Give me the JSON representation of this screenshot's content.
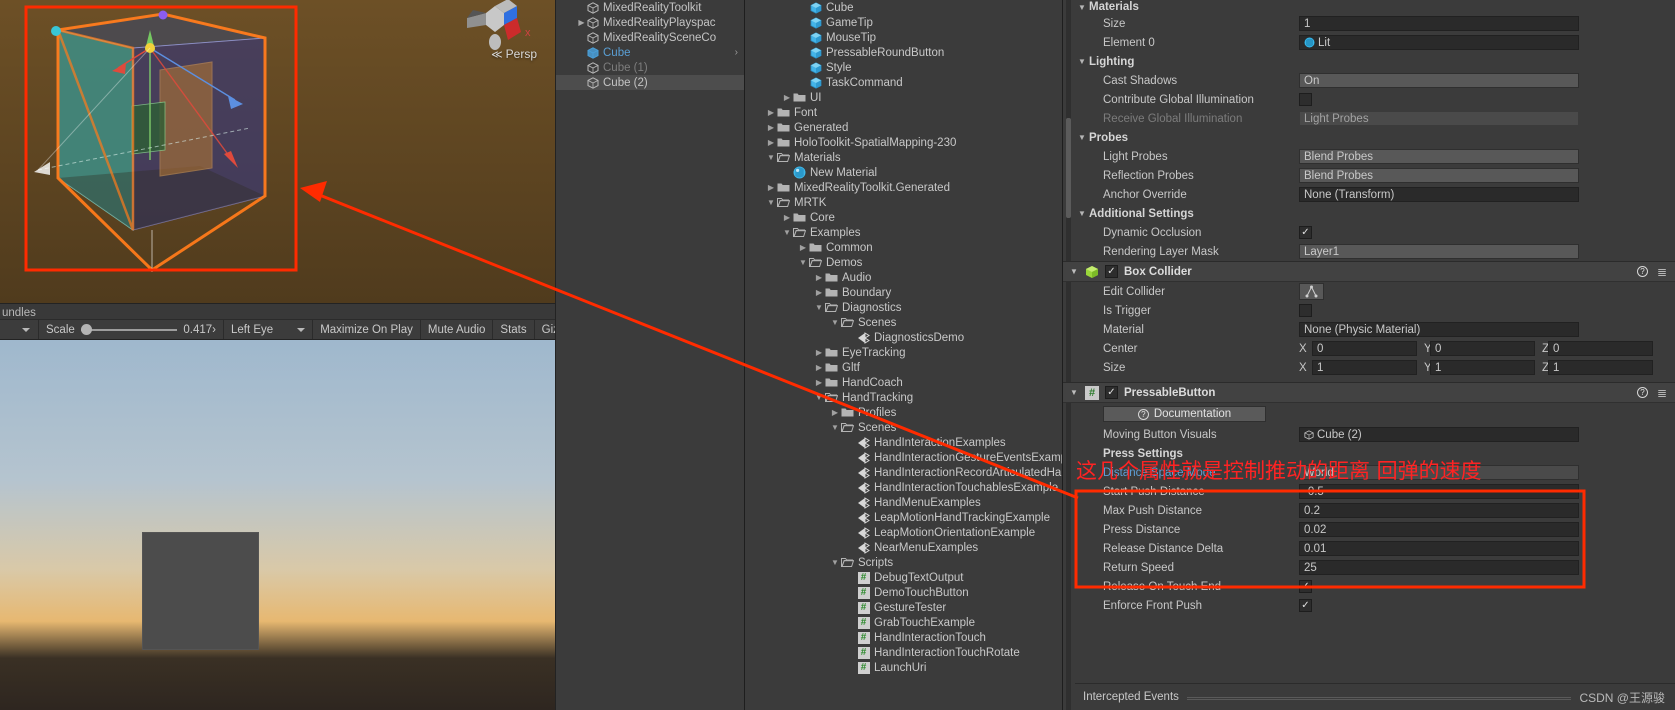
{
  "scene_view": {
    "persp_label": "Persp",
    "persp_chevron": "≪"
  },
  "game_view": {
    "tab_label": "undles",
    "toolbar": {
      "display_caret": "▾",
      "scale_label": "Scale",
      "scale_value": "0.417›",
      "eye_label": "Left Eye",
      "eye_caret": "▾",
      "maximize_on_play": "Maximize On Play",
      "mute_audio": "Mute Audio",
      "stats": "Stats",
      "gizmos": "Gizmos",
      "gizmos_caret": "▾"
    }
  },
  "hierarchy": {
    "items": [
      {
        "label": "MixedRealityToolkit",
        "arrow": "",
        "selected": false,
        "active": false,
        "dim": false
      },
      {
        "label": "MixedRealityPlayspac",
        "arrow": "▶",
        "selected": false,
        "active": false,
        "dim": false
      },
      {
        "label": "MixedRealitySceneCo",
        "arrow": "",
        "selected": false,
        "active": false,
        "dim": false
      },
      {
        "label": "Cube",
        "arrow": "",
        "selected": false,
        "active": true,
        "dim": false,
        "more": "›"
      },
      {
        "label": "Cube (1)",
        "arrow": "",
        "selected": false,
        "active": false,
        "dim": true
      },
      {
        "label": "Cube (2)",
        "arrow": "",
        "selected": true,
        "active": false,
        "dim": false
      }
    ]
  },
  "project": {
    "items": [
      {
        "label": "Cube",
        "indent": 3,
        "arrow": "",
        "icon": "prefab",
        "open": false
      },
      {
        "label": "GameTip",
        "indent": 3,
        "arrow": "",
        "icon": "prefab",
        "open": false
      },
      {
        "label": "MouseTip",
        "indent": 3,
        "arrow": "",
        "icon": "prefab",
        "open": false
      },
      {
        "label": "PressableRoundButton",
        "indent": 3,
        "arrow": "",
        "icon": "prefab",
        "open": false
      },
      {
        "label": "Style",
        "indent": 3,
        "arrow": "",
        "icon": "prefab",
        "open": false
      },
      {
        "label": "TaskCommand",
        "indent": 3,
        "arrow": "",
        "icon": "prefab",
        "open": false
      },
      {
        "label": "UI",
        "indent": 2,
        "arrow": "▶",
        "icon": "folder",
        "open": false
      },
      {
        "label": "Font",
        "indent": 1,
        "arrow": "▶",
        "icon": "folder",
        "open": false
      },
      {
        "label": "Generated",
        "indent": 1,
        "arrow": "▶",
        "icon": "folder",
        "open": false
      },
      {
        "label": "HoloToolkit-SpatialMapping-230",
        "indent": 1,
        "arrow": "▶",
        "icon": "folder",
        "open": false
      },
      {
        "label": "Materials",
        "indent": 1,
        "arrow": "▼",
        "icon": "folder",
        "open": true
      },
      {
        "label": "New Material",
        "indent": 2,
        "arrow": "",
        "icon": "material",
        "open": false
      },
      {
        "label": "MixedRealityToolkit.Generated",
        "indent": 1,
        "arrow": "▶",
        "icon": "folder",
        "open": false
      },
      {
        "label": "MRTK",
        "indent": 1,
        "arrow": "▼",
        "icon": "folder",
        "open": true
      },
      {
        "label": "Core",
        "indent": 2,
        "arrow": "▶",
        "icon": "folder",
        "open": false
      },
      {
        "label": "Examples",
        "indent": 2,
        "arrow": "▼",
        "icon": "folder",
        "open": true
      },
      {
        "label": "Common",
        "indent": 3,
        "arrow": "▶",
        "icon": "folder",
        "open": false
      },
      {
        "label": "Demos",
        "indent": 3,
        "arrow": "▼",
        "icon": "folder",
        "open": true
      },
      {
        "label": "Audio",
        "indent": 4,
        "arrow": "▶",
        "icon": "folder",
        "open": false
      },
      {
        "label": "Boundary",
        "indent": 4,
        "arrow": "▶",
        "icon": "folder",
        "open": false
      },
      {
        "label": "Diagnostics",
        "indent": 4,
        "arrow": "▼",
        "icon": "folder",
        "open": true
      },
      {
        "label": "Scenes",
        "indent": 5,
        "arrow": "▼",
        "icon": "folder",
        "open": true
      },
      {
        "label": "DiagnosticsDemo",
        "indent": 6,
        "arrow": "",
        "icon": "scene",
        "open": false
      },
      {
        "label": "EyeTracking",
        "indent": 4,
        "arrow": "▶",
        "icon": "folder",
        "open": false
      },
      {
        "label": "Gltf",
        "indent": 4,
        "arrow": "▶",
        "icon": "folder",
        "open": false
      },
      {
        "label": "HandCoach",
        "indent": 4,
        "arrow": "▶",
        "icon": "folder",
        "open": false
      },
      {
        "label": "HandTracking",
        "indent": 4,
        "arrow": "▼",
        "icon": "folder",
        "open": true
      },
      {
        "label": "Profiles",
        "indent": 5,
        "arrow": "▶",
        "icon": "folder",
        "open": false
      },
      {
        "label": "Scenes",
        "indent": 5,
        "arrow": "▼",
        "icon": "folder",
        "open": true
      },
      {
        "label": "HandInteractionExamples",
        "indent": 6,
        "arrow": "",
        "icon": "scene",
        "open": false
      },
      {
        "label": "HandInteractionGestureEventsExamp",
        "indent": 6,
        "arrow": "",
        "icon": "scene",
        "open": false
      },
      {
        "label": "HandInteractionRecordArticulatedHa",
        "indent": 6,
        "arrow": "",
        "icon": "scene",
        "open": false
      },
      {
        "label": "HandInteractionTouchablesExample",
        "indent": 6,
        "arrow": "",
        "icon": "scene",
        "open": false
      },
      {
        "label": "HandMenuExamples",
        "indent": 6,
        "arrow": "",
        "icon": "scene",
        "open": false
      },
      {
        "label": "LeapMotionHandTrackingExample",
        "indent": 6,
        "arrow": "",
        "icon": "scene",
        "open": false
      },
      {
        "label": "LeapMotionOrientationExample",
        "indent": 6,
        "arrow": "",
        "icon": "scene",
        "open": false
      },
      {
        "label": "NearMenuExamples",
        "indent": 6,
        "arrow": "",
        "icon": "scene",
        "open": false
      },
      {
        "label": "Scripts",
        "indent": 5,
        "arrow": "▼",
        "icon": "folder",
        "open": true
      },
      {
        "label": "DebugTextOutput",
        "indent": 6,
        "arrow": "",
        "icon": "script",
        "open": false
      },
      {
        "label": "DemoTouchButton",
        "indent": 6,
        "arrow": "",
        "icon": "script",
        "open": false
      },
      {
        "label": "GestureTester",
        "indent": 6,
        "arrow": "",
        "icon": "script",
        "open": false
      },
      {
        "label": "GrabTouchExample",
        "indent": 6,
        "arrow": "",
        "icon": "script",
        "open": false
      },
      {
        "label": "HandInteractionTouch",
        "indent": 6,
        "arrow": "",
        "icon": "script",
        "open": false
      },
      {
        "label": "HandInteractionTouchRotate",
        "indent": 6,
        "arrow": "",
        "icon": "script",
        "open": false
      },
      {
        "label": "LaunchUri",
        "indent": 6,
        "arrow": "",
        "icon": "script",
        "open": false
      }
    ]
  },
  "inspector": {
    "materials": {
      "header": "Materials",
      "size_label": "Size",
      "size_value": "1",
      "element0_label": "Element 0",
      "element0_value": "Lit"
    },
    "lighting": {
      "header": "Lighting",
      "cast_shadows_label": "Cast Shadows",
      "cast_shadows_value": "On",
      "contribute_gi_label": "Contribute Global Illumination",
      "contribute_gi_checked": false,
      "receive_gi_label": "Receive Global Illumination",
      "receive_gi_value": "Light Probes"
    },
    "probes": {
      "header": "Probes",
      "light_probes_label": "Light Probes",
      "light_probes_value": "Blend Probes",
      "reflection_probes_label": "Reflection Probes",
      "reflection_probes_value": "Blend Probes",
      "anchor_override_label": "Anchor Override",
      "anchor_override_value": "None (Transform)"
    },
    "additional": {
      "header": "Additional Settings",
      "dynamic_occlusion_label": "Dynamic Occlusion",
      "dynamic_occlusion_checked": true,
      "rendering_layer_mask_label": "Rendering Layer Mask",
      "rendering_layer_mask_value": "Layer1"
    },
    "box_collider": {
      "title": "Box Collider",
      "enabled": true,
      "edit_collider_label": "Edit Collider",
      "is_trigger_label": "Is Trigger",
      "is_trigger_checked": false,
      "material_label": "Material",
      "material_value": "None (Physic Material)",
      "center_label": "Center",
      "center": {
        "x": "0",
        "y": "0",
        "z": "0"
      },
      "size_label": "Size",
      "size": {
        "x": "1",
        "y": "1",
        "z": "1"
      },
      "axis_x": "X",
      "axis_y": "Y",
      "axis_z": "Z",
      "help_icon": "?",
      "menu_icon": "☰"
    },
    "pressable_button": {
      "title": "PressableButton",
      "enabled": true,
      "documentation_label": "Documentation",
      "moving_button_visuals_label": "Moving Button Visuals",
      "moving_button_visuals_value": "Cube (2)",
      "press_settings_label": "Press Settings",
      "distance_space_mode_label": "Distance Space Mode",
      "distance_space_mode_value": "World",
      "rows": [
        {
          "label": "Start Push Distance",
          "value": "-0.5"
        },
        {
          "label": "Max Push Distance",
          "value": "0.2"
        },
        {
          "label": "Press Distance",
          "value": "0.02"
        },
        {
          "label": "Release Distance Delta",
          "value": "0.01"
        },
        {
          "label": "Return Speed",
          "value": "25"
        }
      ],
      "release_on_touch_end_label": "Release On Touch End",
      "release_on_touch_end_checked": true,
      "enforce_front_push_label": "Enforce Front Push",
      "enforce_front_push_checked": true
    },
    "events": {
      "header": "Intercepted Events"
    },
    "watermark": "CSDN @王源骏"
  },
  "annotations": {
    "chinese_note": "这几个属性就是控制推动的距离 回弹的速度",
    "accent_color": "#ff2b00",
    "text_color": "#ff2323"
  }
}
